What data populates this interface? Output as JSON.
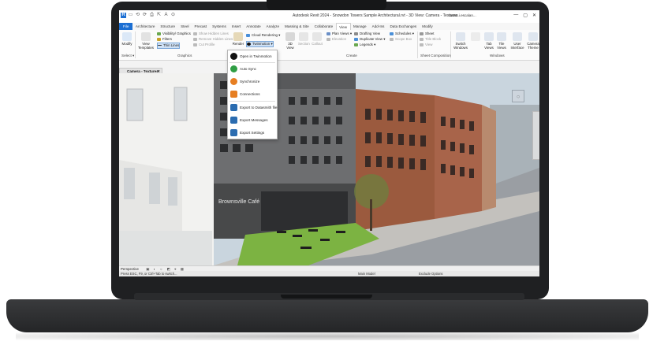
{
  "window": {
    "title": "Autodesk Revit 2024 - Snowdon Towers Sample Architectural.rvt - 3D View: Camera - Textures",
    "user": "rasan.i.escalan...",
    "controls": [
      "—",
      "▢",
      "✕"
    ]
  },
  "quick_access": [
    "R",
    "▭",
    "⟲",
    "⟳",
    "⎙",
    "⇱",
    "A",
    "⊙"
  ],
  "tabs": [
    "File",
    "Architecture",
    "Structure",
    "Steel",
    "Precast",
    "Systems",
    "Insert",
    "Annotate",
    "Analyze",
    "Massing & Site",
    "Collaborate",
    "View",
    "Manage",
    "Add-Ins",
    "Data Exchanges",
    "Modify"
  ],
  "active_tab": "View",
  "ribbon": {
    "modify": "Modify",
    "view_templates": "View Templates",
    "visibility_graphics": "Visibility/ Graphics",
    "filters": "Filters",
    "thin_lines": "Thin Lines",
    "show_hidden_lines": "Show Hidden Lines",
    "remove_hidden_lines": "Remove Hidden Lines",
    "cut_profile": "Cut Profile",
    "render": "Render",
    "cloud_rendering": "Cloud Rendering",
    "twinmotion": "Twinmotion",
    "view_3d": "3D View",
    "section": "Section",
    "callout": "Callout",
    "plan_views": "Plan Views",
    "elevation": "Elevation",
    "drafting_view": "Drafting View",
    "duplicate_view": "Duplicate View",
    "legends": "Legends",
    "schedules": "Schedules",
    "scope_box": "Scope Box",
    "sheet": "Sheet",
    "title_block": "Title Block",
    "view": "View",
    "switch_windows": "Switch Windows",
    "tab_views": "Tab Views",
    "tile_views": "Tile Views",
    "user_interface": "User Interface",
    "camera_theme": "Camera Theme",
    "panels": {
      "select": "Select",
      "graphics": "Graphics",
      "create": "Create",
      "sheet_composition": "Sheet Composition",
      "windows": "Windows"
    }
  },
  "twinmotion_menu": [
    {
      "label": "Open in Twinmotion",
      "icon": "twinmotion-logo-icon",
      "color": "#111111"
    },
    {
      "label": "Auto Sync",
      "icon": "auto-sync-icon",
      "color": "#2f9e44"
    },
    {
      "label": "Synchronize",
      "icon": "synchronize-icon",
      "color": "#e67e22"
    },
    {
      "label": "Connections",
      "icon": "connections-icon",
      "color": "#e67e22"
    },
    {
      "label": "Export to Datasmith file",
      "icon": "export-datasmith-icon",
      "color": "#2b6cb0"
    },
    {
      "label": "Export Messages",
      "icon": "export-messages-icon",
      "color": "#2b6cb0"
    },
    {
      "label": "Export Settings",
      "icon": "export-settings-icon",
      "color": "#2b6cb0"
    }
  ],
  "view_tab": "Camera - Textures",
  "scene": {
    "cafe_sign": "Brownsville Café"
  },
  "view_control_bar": {
    "projection": "Perspective"
  },
  "status_bar": {
    "hint": "Press ESC, F9, or Ctrl+Tab to switch...",
    "model": "Main Model",
    "exclude_options": "Exclude Options"
  },
  "colors": {
    "accent": "#1c6fd3",
    "bezel": "#1f2022"
  }
}
